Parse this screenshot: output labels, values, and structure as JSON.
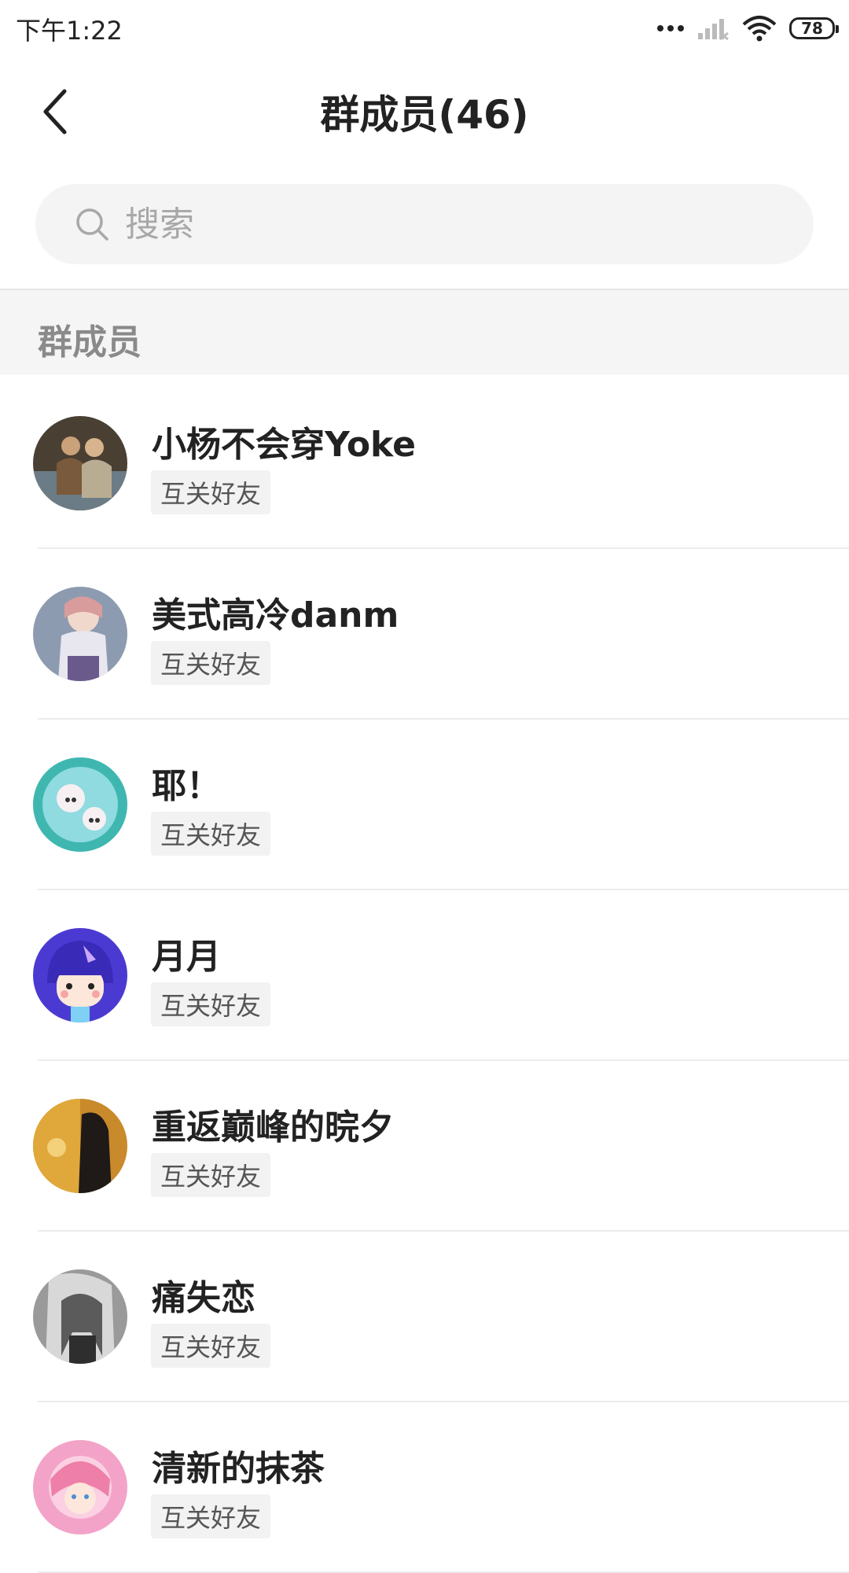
{
  "status_bar": {
    "time": "下午1:22",
    "battery": "78"
  },
  "header": {
    "title": "群成员(46)"
  },
  "search": {
    "placeholder": "搜索"
  },
  "section": {
    "label": "群成员"
  },
  "members": [
    {
      "name": "小杨不会穿Yoke",
      "tag": "互关好友"
    },
    {
      "name": "美式高冷danm",
      "tag": "互关好友"
    },
    {
      "name": "耶！",
      "tag": "互关好友"
    },
    {
      "name": "月月",
      "tag": "互关好友"
    },
    {
      "name": "重返巅峰的晥夕",
      "tag": "互关好友"
    },
    {
      "name": "痛失恋",
      "tag": "互关好友"
    },
    {
      "name": "清新的抹茶",
      "tag": "互关好友"
    }
  ],
  "colors": {
    "background": "#ffffff",
    "section_bg": "#f5f5f5",
    "tag_bg": "#f2f2f2",
    "text_primary": "#222222",
    "text_muted": "#8a8a8a"
  }
}
